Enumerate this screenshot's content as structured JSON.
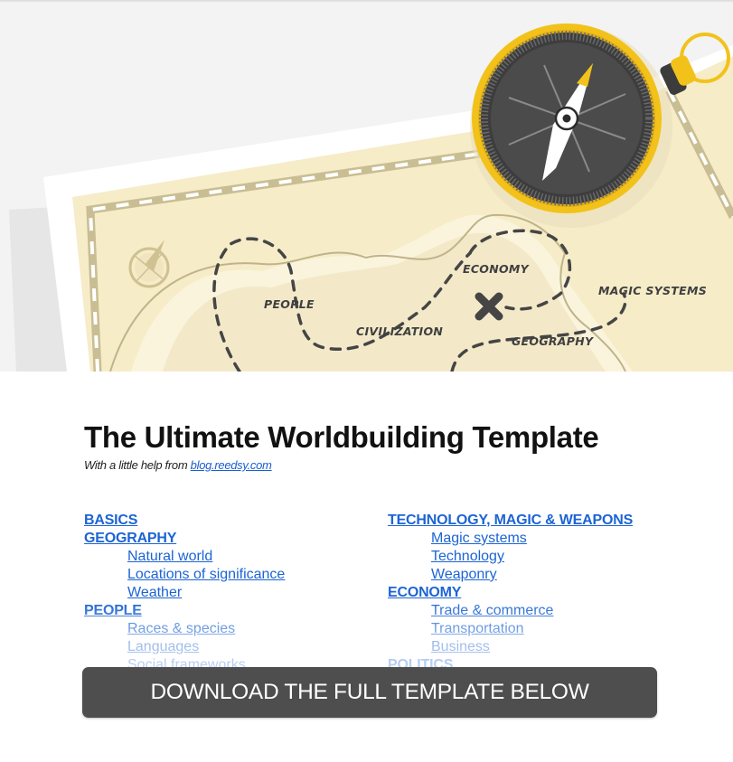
{
  "banner": {
    "description": "Illustrated treasure map with compass",
    "map_labels": {
      "people": "PEOPLE",
      "civilization": "CIVILIZATION",
      "economy": "ECONOMY",
      "geography": "GEOGRAPHY",
      "magic_systems": "MAGIC SYSTEMS"
    },
    "icons": {
      "compass": "compass-icon",
      "compass_rose": "compass-rose-icon",
      "treasure_x": "x-mark-icon"
    },
    "colors": {
      "parchment": "#f6ecc8",
      "compass_gold": "#f2c21b",
      "compass_face": "#4b4b4b",
      "path": "#454545"
    }
  },
  "header": {
    "title": "The Ultimate Worldbuilding Template",
    "subtitle_prefix": "With a little help from ",
    "subtitle_link": "blog.reedsy.com"
  },
  "toc": {
    "left": [
      {
        "label": "BASICS",
        "level": "section"
      },
      {
        "label": "GEOGRAPHY",
        "level": "section"
      },
      {
        "label": "Natural world",
        "level": "sub"
      },
      {
        "label": "Locations of significance",
        "level": "sub"
      },
      {
        "label": "Weather",
        "level": "sub"
      },
      {
        "label": "PEOPLE",
        "level": "section"
      },
      {
        "label": "Races & species",
        "level": "sub"
      },
      {
        "label": "Languages",
        "level": "sub"
      },
      {
        "label": "Social frameworks",
        "level": "sub"
      }
    ],
    "right": [
      {
        "label": "TECHNOLOGY, MAGIC & WEAPONS",
        "level": "section"
      },
      {
        "label": "Magic systems",
        "level": "sub"
      },
      {
        "label": "Technology",
        "level": "sub"
      },
      {
        "label": "Weaponry",
        "level": "sub"
      },
      {
        "label": "ECONOMY",
        "level": "section"
      },
      {
        "label": "Trade & commerce",
        "level": "sub"
      },
      {
        "label": "Transportation",
        "level": "sub"
      },
      {
        "label": "Business",
        "level": "sub"
      },
      {
        "label": "POLITICS",
        "level": "section"
      }
    ],
    "link_color": "#1c64d4"
  },
  "cta": {
    "label": "DOWNLOAD THE FULL TEMPLATE BELOW",
    "background": "#4e4e4e"
  }
}
